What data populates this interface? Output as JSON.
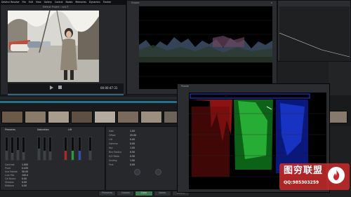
{
  "app": {
    "menu": [
      "DaVinci Resolve",
      "File",
      "Edit",
      "View",
      "Gallery",
      "Control",
      "Nodes",
      "Memories",
      "Dynamics",
      "Tracker"
    ],
    "project_title": "Default Project : noLUT",
    "viewer_readout": "00:00:00:00",
    "timecode": "00:00:47:31"
  },
  "waveform_scope": {
    "title": "Scopes",
    "close_label": "x"
  },
  "parade_scope": {
    "title": "Parade"
  },
  "timeline": {
    "clip_count": 15
  },
  "panels": {
    "left_header": "Primaries",
    "mid_header": "Saturation",
    "right_header": "Lift",
    "mid_labels": [
      "Hue",
      "Sat",
      "Lum",
      "Gain"
    ],
    "params": [
      "Contrast",
      "Pivot",
      "Hue Rotate",
      "Lum Mix",
      "Col Boost",
      "Shadow",
      "Midtone"
    ],
    "param_values": [
      "1.000",
      "0.435",
      "50.00",
      "100.0",
      "0.00",
      "0.00",
      "0.00"
    ]
  },
  "right_panel": {
    "labels": [
      "Gain",
      "Offset",
      "Lift",
      "Gamma",
      "Key",
      "Blur Radius",
      "H/V Ratio",
      "Scaling",
      "Fine"
    ],
    "values": [
      "1.00",
      "25.00",
      "0.00",
      "0.00",
      "1.00",
      "0.50",
      "0.50",
      "1.00",
      "0.00"
    ]
  },
  "bottom_tabs": [
    "Primaries",
    "Custom",
    "Color",
    "Nodes",
    "Gallery"
  ],
  "active_tab_index": 2,
  "watermark": {
    "text": "图穷联盟",
    "sub": "QQ:985303259",
    "accent_color": "#c62a2a",
    "text_color": "#ffffff",
    "logo_icon": "flame-icon"
  },
  "colors": {
    "accent_green": "#3d7b52",
    "scope_bg": "#000000",
    "panel_bg": "#26282b"
  }
}
